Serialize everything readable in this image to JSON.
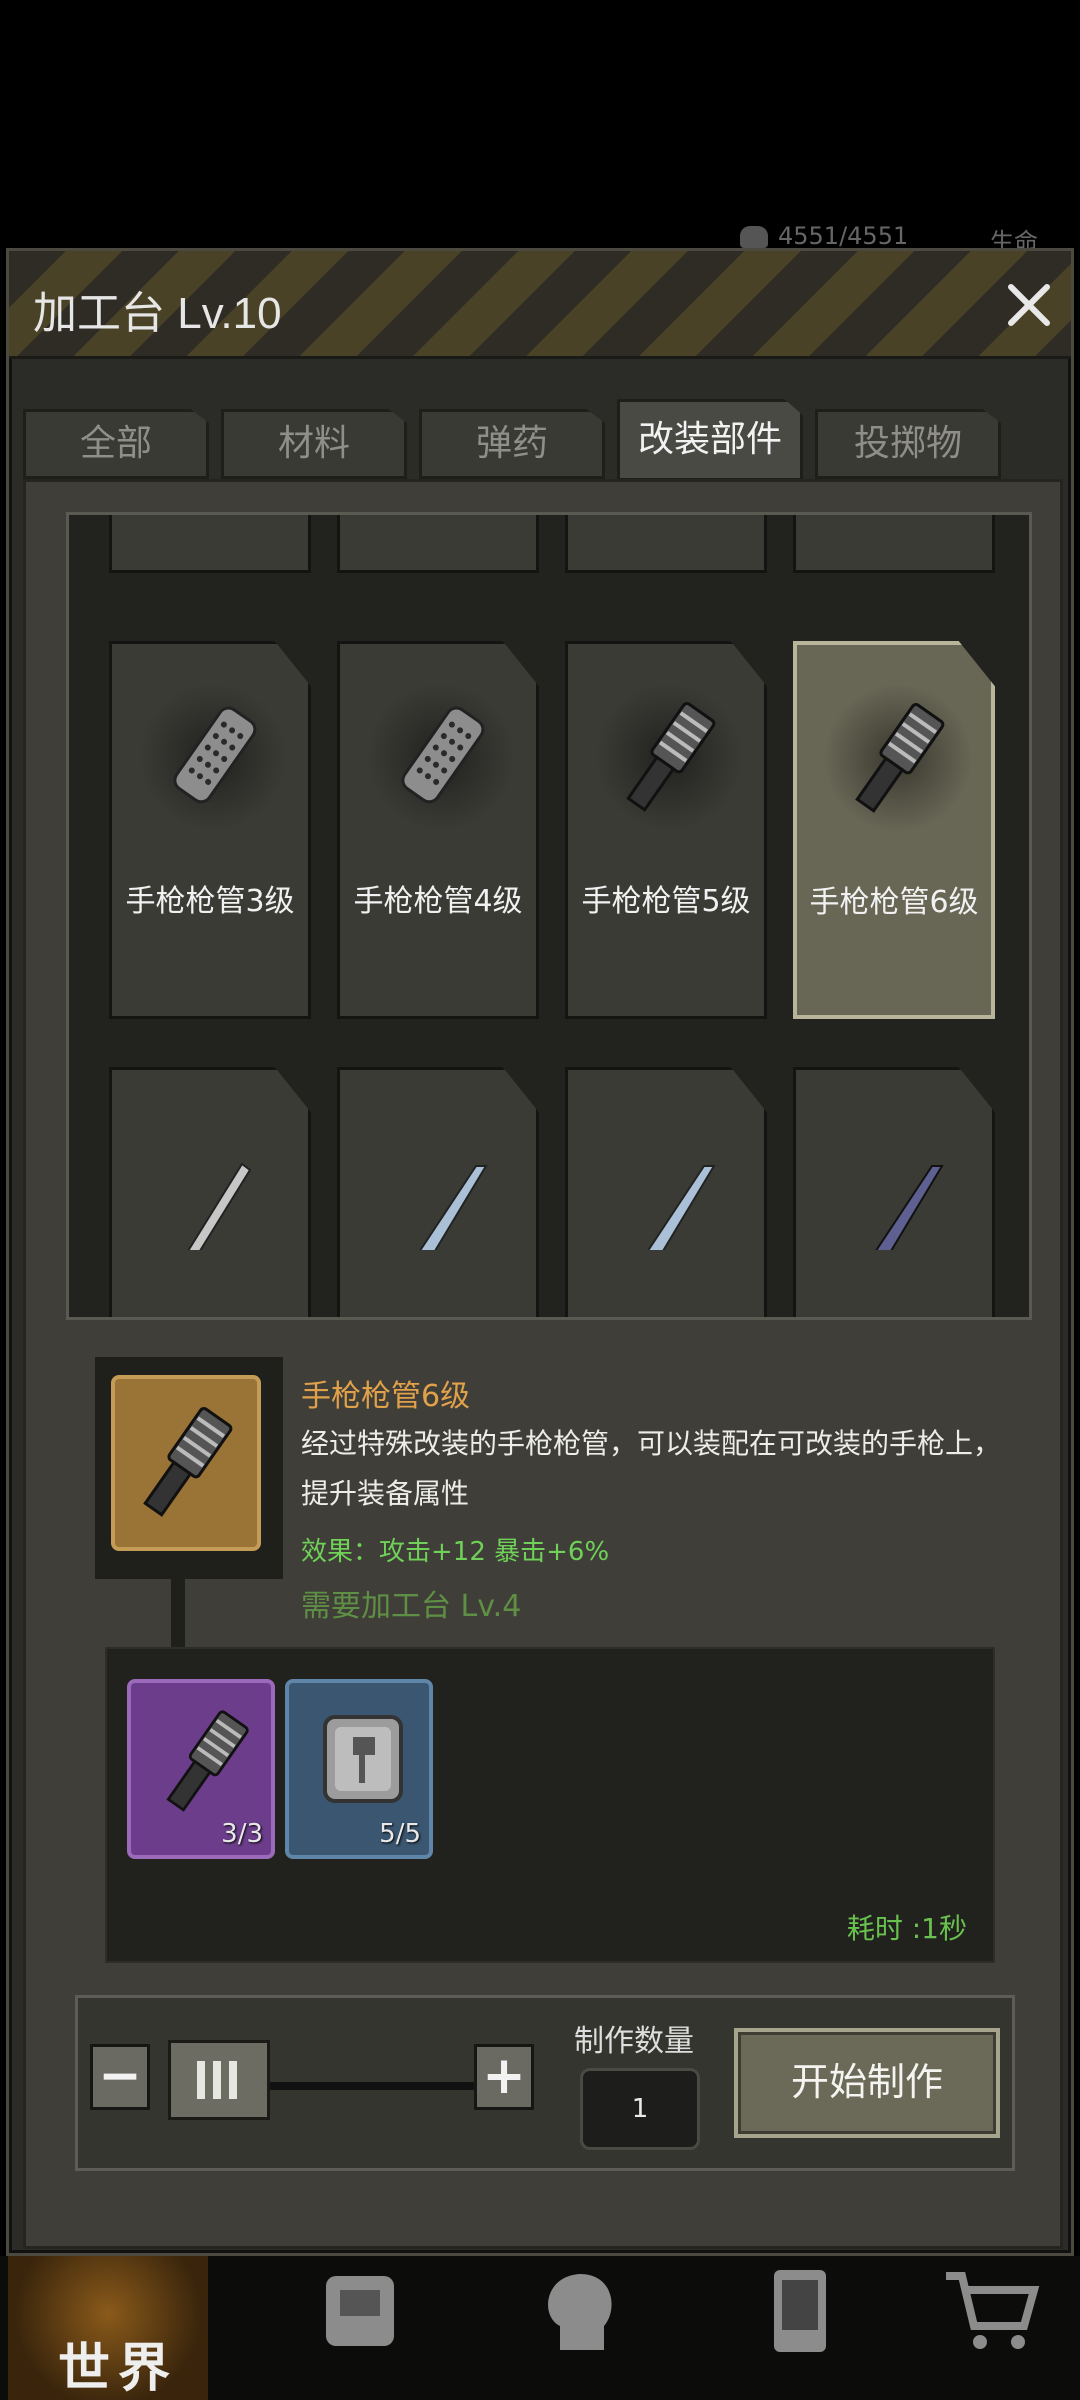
{
  "status": {
    "hp": "4551/4551",
    "life_label": "生命"
  },
  "header": {
    "title": "加工台 Lv.10"
  },
  "tabs": [
    {
      "label": "全部",
      "active": false
    },
    {
      "label": "材料",
      "active": false
    },
    {
      "label": "弹药",
      "active": false
    },
    {
      "label": "改装部件",
      "active": true
    },
    {
      "label": "投掷物",
      "active": false
    }
  ],
  "items": [
    {
      "label": "手枪枪管3级",
      "icon": "perforated-barrel-icon",
      "selected": false
    },
    {
      "label": "手枪枪管4级",
      "icon": "perforated-barrel-icon",
      "selected": false
    },
    {
      "label": "手枪枪管5级",
      "icon": "ribbed-barrel-icon",
      "selected": false
    },
    {
      "label": "手枪枪管6级",
      "icon": "ribbed-barrel-icon",
      "selected": true
    }
  ],
  "next_row_icons": [
    "knife-icon",
    "blade-icon",
    "blade-icon",
    "serrated-blade-icon"
  ],
  "detail": {
    "name": "手枪枪管6级",
    "description": "经过特殊改装的手枪枪管，可以装配在可改装的手枪上，提升装备属性",
    "effect": "效果：攻击+12 暴击+6%",
    "requirement": "需要加工台 Lv.4"
  },
  "materials": [
    {
      "icon": "ribbed-barrel-icon",
      "count": "3/3",
      "color": "#6b3d8a"
    },
    {
      "icon": "axe-plate-icon",
      "count": "5/5",
      "color": "#3a5670"
    }
  ],
  "time_label": "耗时 :1秒",
  "controls": {
    "minus": "−",
    "plus": "+",
    "quantity_label": "制作数量",
    "quantity": "1",
    "start_label": "开始制作"
  },
  "bottom_nav": {
    "world_label": "世界"
  },
  "colors": {
    "accent_gold": "#e0a14a",
    "effect_green": "#6fd158",
    "selected_card": "#686655"
  }
}
